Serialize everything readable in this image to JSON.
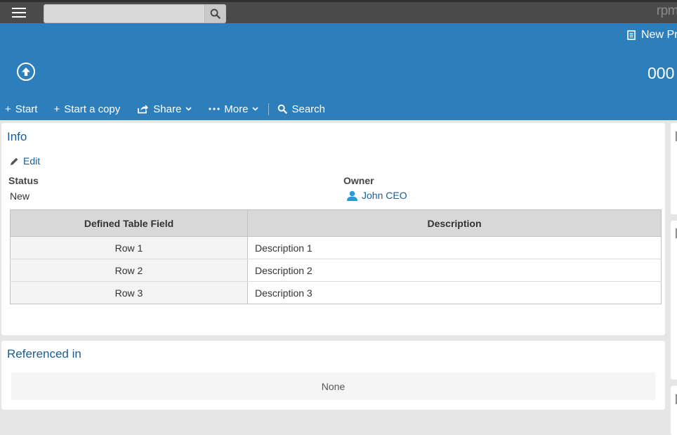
{
  "topbar": {
    "search_placeholder": "",
    "search_value": "",
    "logo": "rpm"
  },
  "header": {
    "process_name": "New Pr",
    "form_number": "000"
  },
  "actions": {
    "start": "Start",
    "start_copy": "Start a copy",
    "share": "Share",
    "more": "More",
    "search": "Search"
  },
  "info": {
    "title": "Info",
    "edit": "Edit",
    "status_label": "Status",
    "status_value": "New",
    "owner_label": "Owner",
    "owner_value": "John CEO",
    "table": {
      "headers": [
        "Defined Table Field",
        "Description"
      ],
      "rows": [
        [
          "Row 1",
          "Description 1"
        ],
        [
          "Row 2",
          "Description 2"
        ],
        [
          "Row 3",
          "Description 3"
        ]
      ]
    }
  },
  "refs": {
    "title": "Referenced in",
    "none": "None"
  },
  "colors": {
    "header_blue": "#2d7fbc",
    "link_blue": "#1a5c92",
    "topbar": "#4a4a4a"
  }
}
